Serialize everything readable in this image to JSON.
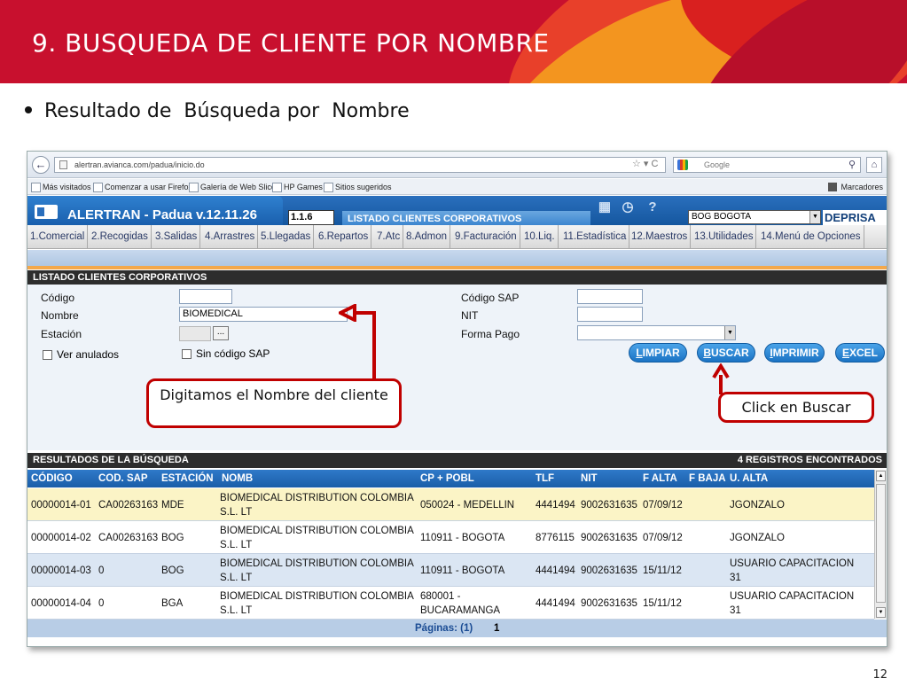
{
  "slide": {
    "title": "9.  BUSQUEDA DE CLIENTE POR NOMBRE",
    "bullet": "Resultado de  Búsqueda por  Nombre",
    "page_number": "12"
  },
  "browser": {
    "url": "alertran.avianca.com/padua/inicio.do",
    "search_placeholder": "Google",
    "bookmarks": [
      "Más visitados",
      "Comenzar a usar Firefox",
      "Galería de Web Slice",
      "HP Games",
      "Sitios sugeridos"
    ],
    "bookmarks_right": "Marcadores"
  },
  "app": {
    "title": "ALERTRAN - Padua  v.12.11.26",
    "code": "1.1.6",
    "list_tab": "LISTADO CLIENTES CORPORATIVOS",
    "station": "BOG BOGOTA",
    "brand": "DEPRISA",
    "menu": [
      "1.Comercial",
      "2.Recogidas",
      "3.Salidas",
      "4.Arrastres",
      "5.Llegadas",
      "6.Repartos",
      "7.Atc",
      "8.Admon",
      "9.Facturación",
      "10.Liq.",
      "11.Estadística",
      "12.Maestros",
      "13.Utilidades",
      "14.Menú de Opciones"
    ]
  },
  "form": {
    "section_title": "LISTADO CLIENTES CORPORATIVOS",
    "codigo_label": "Código",
    "nombre_label": "Nombre",
    "nombre_value": "BIOMEDICAL",
    "estacion_label": "Estación",
    "estacion_btn": "...",
    "ver_anulados": "Ver anulados",
    "sin_codigo_sap": "Sin código SAP",
    "codigo_sap_label": "Código SAP",
    "nit_label": "NIT",
    "forma_pago_label": "Forma Pago",
    "buttons": {
      "limpiar_first": "L",
      "limpiar_rest": "IMPIAR",
      "buscar_first": "B",
      "buscar_rest": "USCAR",
      "imprimir_first": "I",
      "imprimir_rest": "MPRIMIR",
      "excel_first": "E",
      "excel_rest": "XCEL"
    }
  },
  "callouts": {
    "nombre": "Digitamos el Nombre del cliente",
    "buscar": "Click en Buscar"
  },
  "results": {
    "section_title": "RESULTADOS DE LA BÚSQUEDA",
    "count": "4  REGISTROS ENCONTRADOS",
    "columns": [
      "CÓDIGO",
      "COD. SAP",
      "ESTACIÓN",
      "NOMB",
      "CP + POBL",
      "TLF",
      "NIT",
      "F ALTA",
      "F BAJA",
      "U. ALTA"
    ],
    "rows": [
      {
        "codigo": "00000014-01",
        "sap": "CA00263163",
        "estacion": "MDE",
        "nombre": "BIOMEDICAL DISTRIBUTION COLOMBIA\nS.L. LT",
        "cp": "050024 - MEDELLIN",
        "tlf": "4441494",
        "nit": "9002631635",
        "f_alta": "07/09/12",
        "f_baja": "",
        "u_alta": "JGONZALO"
      },
      {
        "codigo": "00000014-02",
        "sap": "CA00263163",
        "estacion": "BOG",
        "nombre": "BIOMEDICAL DISTRIBUTION COLOMBIA\nS.L. LT",
        "cp": "110911 - BOGOTA",
        "tlf": "8776115",
        "nit": "9002631635",
        "f_alta": "07/09/12",
        "f_baja": "",
        "u_alta": "JGONZALO"
      },
      {
        "codigo": "00000014-03",
        "sap": "0",
        "estacion": "BOG",
        "nombre": "BIOMEDICAL DISTRIBUTION COLOMBIA\nS.L. LT",
        "cp": "110911 - BOGOTA",
        "tlf": "4441494",
        "nit": "9002631635",
        "f_alta": "15/11/12",
        "f_baja": "",
        "u_alta": "USUARIO CAPACITACION\n31"
      },
      {
        "codigo": "00000014-04",
        "sap": "0",
        "estacion": "BGA",
        "nombre": "BIOMEDICAL DISTRIBUTION COLOMBIA\nS.L. LT",
        "cp": "680001 -\nBUCARAMANGA",
        "tlf": "4441494",
        "nit": "9002631635",
        "f_alta": "15/11/12",
        "f_baja": "",
        "u_alta": "USUARIO CAPACITACION\n31"
      }
    ],
    "pages_label": "Páginas: (1)",
    "current_page": "1"
  },
  "colors": {
    "header_red": "#c8102e",
    "callout_red": "#c00000",
    "app_blue": "#1a5ea8",
    "highlight_row": "#fbf4c6"
  }
}
